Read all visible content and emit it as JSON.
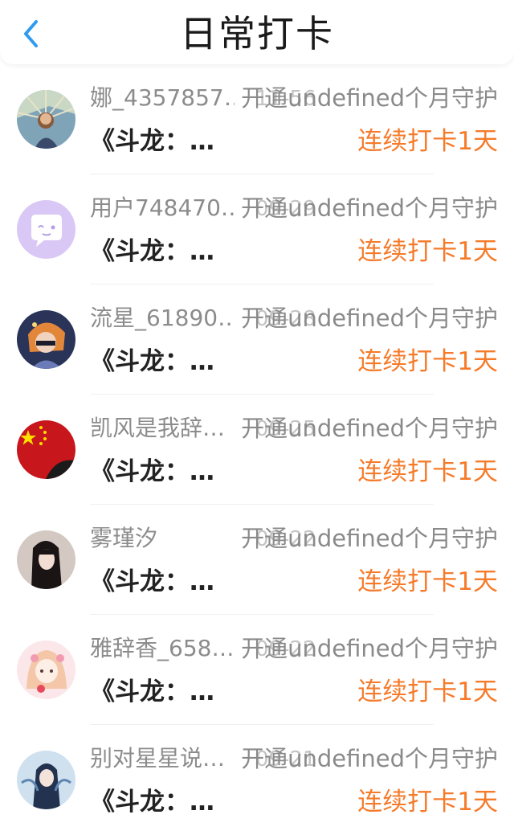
{
  "header": {
    "title": "日常打卡",
    "back_icon": "chevron-left-icon",
    "accent": "#2f9bf0"
  },
  "colors": {
    "streak": "#f57b2b",
    "username": "#8c8c8c",
    "date": "#c4c4c4"
  },
  "rows": [
    {
      "username": "娜_4357857…",
      "date": "11-56",
      "action": "开通undefined个月守护",
      "book": "《斗龙：…",
      "streak": "连续打卡1天"
    },
    {
      "username": "用户748470…",
      "date": "09-29",
      "action": "开通undefined个月守护",
      "book": "《斗龙：…",
      "streak": "连续打卡1天"
    },
    {
      "username": "流星_61890…",
      "date": "09-28",
      "action": "开通undefined个月守护",
      "book": "《斗龙：…",
      "streak": "连续打卡1天"
    },
    {
      "username": "凯风是我辞…",
      "date": "09-25",
      "action": "开通undefined个月守护",
      "book": "《斗龙：…",
      "streak": "连续打卡1天"
    },
    {
      "username": "雾瑾汐",
      "date": "09-22",
      "action": "开通undefined个月守护",
      "book": "《斗龙：…",
      "streak": "连续打卡1天"
    },
    {
      "username": "雅辞香_658…",
      "date": "09-22",
      "action": "开通undefined个月守护",
      "book": "《斗龙：…",
      "streak": "连续打卡1天"
    },
    {
      "username": "别对星星说…",
      "date": "09-21",
      "action": "开通undefined个月守护",
      "book": "《斗龙：…",
      "streak": "连续打卡1天"
    }
  ]
}
